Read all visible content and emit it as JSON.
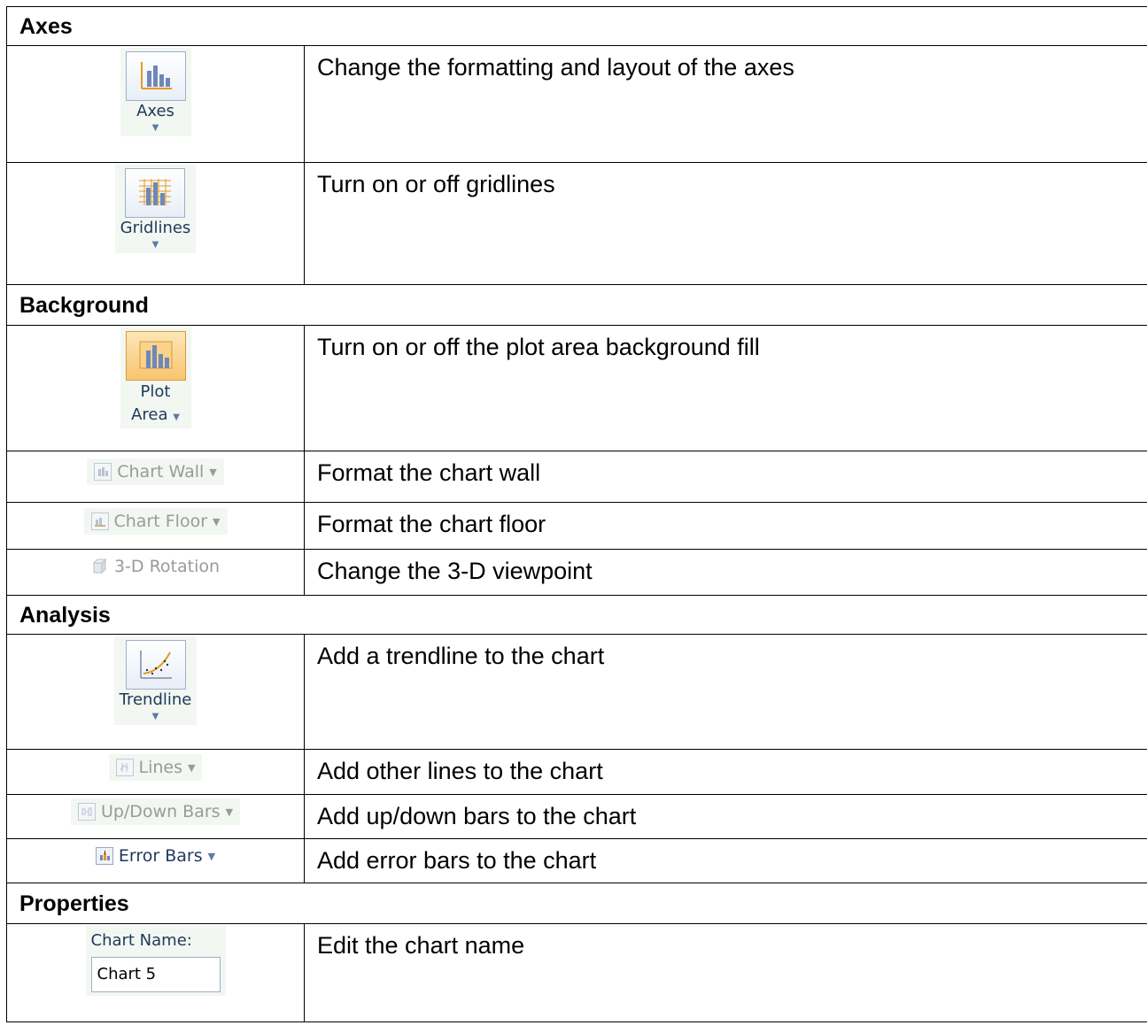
{
  "sections": {
    "axes": "Axes",
    "background": "Background",
    "analysis": "Analysis",
    "properties": "Properties"
  },
  "rows": {
    "axes": {
      "button": "Axes",
      "desc": "Change the formatting and layout of the axes"
    },
    "gridlines": {
      "button": "Gridlines",
      "desc": "Turn on or off gridlines"
    },
    "plot_area": {
      "button_line1": "Plot",
      "button_line2": "Area",
      "desc": "Turn on or off the plot area background fill"
    },
    "chart_wall": {
      "button": "Chart Wall",
      "desc": "Format the chart wall"
    },
    "chart_floor": {
      "button": "Chart Floor",
      "desc": "Format the chart floor"
    },
    "rotation": {
      "button": "3-D Rotation",
      "desc": "Change the 3-D viewpoint"
    },
    "trendline": {
      "button": "Trendline",
      "desc": "Add a trendline to the chart"
    },
    "lines": {
      "button": "Lines",
      "desc": "Add other lines to the chart"
    },
    "updown": {
      "button": "Up/Down Bars",
      "desc": "Add up/down bars to the chart"
    },
    "errorbars": {
      "button": "Error Bars",
      "desc": "Add error bars to the chart"
    },
    "chartname": {
      "label": "Chart Name:",
      "value": "Chart 5",
      "desc": "Edit the chart name"
    }
  },
  "icons": {
    "axes": "axes-icon",
    "gridlines": "gridlines-icon",
    "plot_area": "plot-area-icon",
    "chart_wall": "chart-wall-icon",
    "chart_floor": "chart-floor-icon",
    "rotation": "3d-rotation-icon",
    "trendline": "trendline-icon",
    "lines": "lines-icon",
    "updown": "up-down-bars-icon",
    "errorbars": "error-bars-icon",
    "dropdown": "chevron-down-icon"
  },
  "colors": {
    "ribbon_text": "#1e395b",
    "disabled_text": "#9a9a9a",
    "ribbon_bg": "#f2f7f2",
    "plot_area_fill": "#f7c56f"
  }
}
